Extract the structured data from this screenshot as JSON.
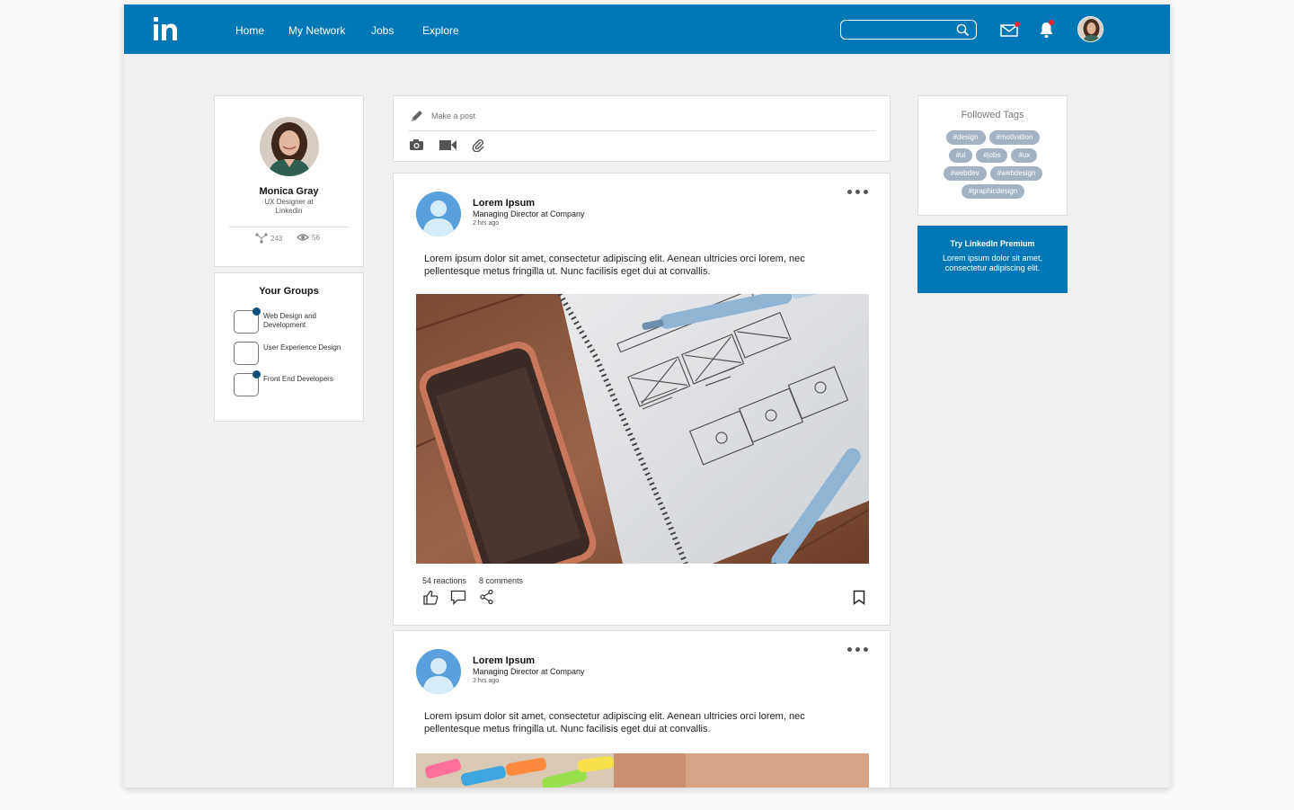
{
  "brand": {
    "logo_text": "in",
    "color": "#0277b5"
  },
  "nav": {
    "items": [
      "Home",
      "My Network",
      "Jobs",
      "Explore"
    ]
  },
  "search": {
    "value": "",
    "placeholder": ""
  },
  "icons": {
    "search": "search-icon",
    "messages": "mail-icon",
    "notifications": "bell-icon",
    "avatar": "user-avatar"
  },
  "profile": {
    "name": "Monica Gray",
    "role": "UX Designer at Linkedin",
    "connections": "243",
    "views": "56"
  },
  "groups": {
    "title": "Your Groups",
    "items": [
      {
        "label": "Web Design and Development",
        "unread": true
      },
      {
        "label": "User Experience Design",
        "unread": false
      },
      {
        "label": "Front End Developers",
        "unread": true
      }
    ]
  },
  "composer": {
    "placeholder": "Make a post"
  },
  "posts": [
    {
      "author": "Lorem Ipsum",
      "title": "Managing Director at Company",
      "time": "2 hrs ago",
      "body": "Lorem ipsum dolor sit amet, consectetur adipiscing elit. Aenean ultricies orci lorem, nec pellentesque metus fringilla ut. Nunc facilisis eget dui at convallis.",
      "reactions": "54 reactions",
      "comments": "8 comments"
    },
    {
      "author": "Lorem Ipsum",
      "title": "Managing Director at Company",
      "time": "3 hrs ago",
      "body": "Lorem ipsum dolor sit amet, consectetur adipiscing elit. Aenean ultricies orci lorem, nec pellentesque metus fringilla ut. Nunc facilisis eget dui at convallis."
    }
  ],
  "followed_tags": {
    "title": "Followed Tags",
    "tags": [
      "#design",
      "#motivation",
      "#ui",
      "#jobs",
      "#ux",
      "#webdev",
      "#webdesign",
      "#graphicdesign"
    ]
  },
  "premium": {
    "title": "Try LinkedIn Premium",
    "text": "Lorem ipsum dolor sit amet, consectetur adipiscing elit."
  },
  "colors": {
    "accent": "#0277b5",
    "tag": "#a3b3c3",
    "notification": "#e8262d"
  }
}
